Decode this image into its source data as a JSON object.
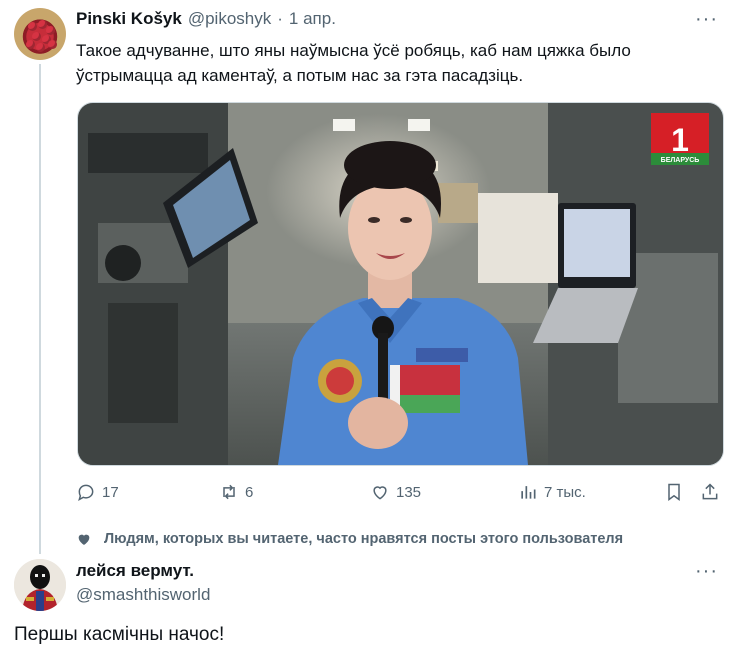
{
  "tweet": {
    "author_name": "Pinski Košyk",
    "author_handle": "@pikoshyk",
    "separator": "·",
    "date": "1 апр.",
    "more": "···",
    "text": "Такое адчуванне, што яны наўмысна ўсё робяць, каб нам цяжка было ўстрымацца ад каментаў, а потым нас за гэта пасадзіць.",
    "media": {
      "channel_logo_number": "1",
      "channel_logo_text": "БЕЛАРУСЬ"
    },
    "actions": {
      "replies": "17",
      "reposts": "6",
      "likes": "135",
      "views": "7 тыс."
    }
  },
  "social_context": {
    "text": "Людям, которых вы читаете, часто нравятся посты этого пользователя"
  },
  "reply": {
    "author_name": "лейся вермут.",
    "author_handle": "@smashthisworld",
    "more": "···",
    "text": "Першы касмічны начос!"
  },
  "colors": {
    "text": "#0f1419",
    "secondary": "#536471",
    "border": "#cfd9de",
    "flag_red": "#c8313e",
    "flag_green": "#4aa657",
    "suit_blue": "#4f86d1"
  },
  "icons": [
    "reply-icon",
    "repost-icon",
    "like-icon",
    "views-icon",
    "bookmark-icon",
    "share-icon",
    "heart-icon"
  ]
}
